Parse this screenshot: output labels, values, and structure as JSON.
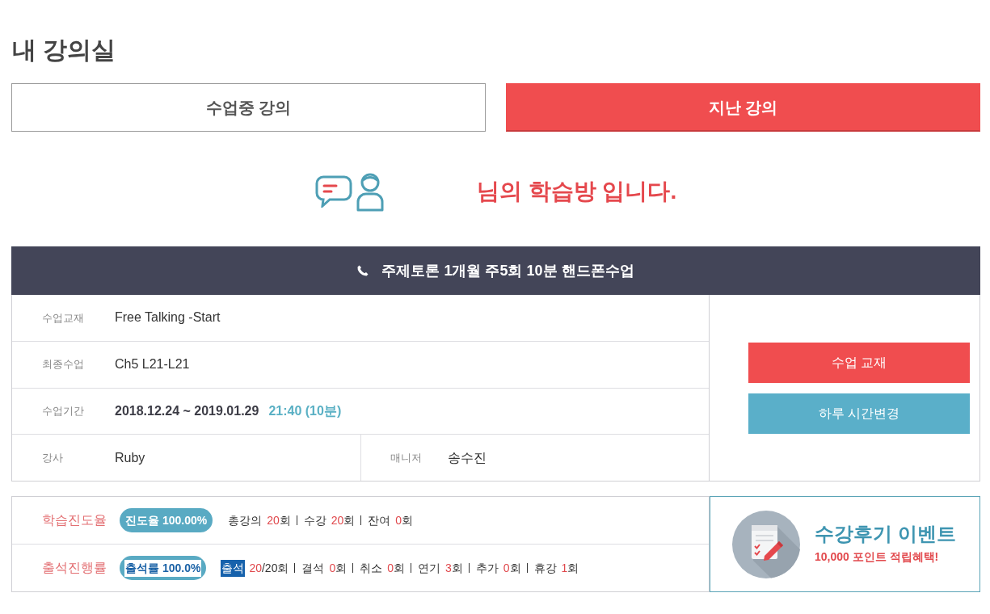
{
  "page_title": "내 강의실",
  "tabs": [
    {
      "label": "수업중 강의",
      "selected": false
    },
    {
      "label": "지난 강의",
      "selected": true
    }
  ],
  "greeting": {
    "text": "님의 학습방 입니다."
  },
  "course": {
    "title": "주제토론 1개월 주5회 10분 핸드폰수업",
    "info_rows": [
      {
        "kind": "text",
        "fields": [
          {
            "label": "수업교재",
            "value": "Free Talking -Start"
          }
        ]
      },
      {
        "kind": "text",
        "fields": [
          {
            "label": "최종수업",
            "value": "Ch5 L21-L21"
          }
        ]
      },
      {
        "kind": "period",
        "fields": [
          {
            "label": "수업기간",
            "value": "2018.12.24 ~ 2019.01.29",
            "time": "21:40 (10분)"
          }
        ]
      },
      {
        "kind": "split",
        "fields": [
          {
            "label": "강사",
            "value": "Ruby"
          },
          {
            "label": "매니저",
            "value": "송수진"
          }
        ]
      }
    ],
    "buttons": [
      {
        "label": "수업 교재",
        "kind": "primary"
      },
      {
        "label": "하루 시간변경",
        "kind": "secondary"
      }
    ]
  },
  "progress": [
    {
      "label": "학습진도율",
      "badge": {
        "text": "진도율 100.00%",
        "highlighted": false
      },
      "stats": [
        {
          "label": "총강의",
          "count": "20",
          "unit": "회",
          "highlighted": false
        },
        {
          "label": "수강",
          "count": "20",
          "unit": "회",
          "highlighted": false
        },
        {
          "label": "잔여",
          "count": "0",
          "unit": "회",
          "highlighted": false
        }
      ]
    },
    {
      "label": "출석진행률",
      "badge": {
        "text": "출석률 100.0%",
        "highlighted": true
      },
      "stats": [
        {
          "label": "출석",
          "count": "20",
          "unit": "/20회",
          "highlighted": true
        },
        {
          "label": "결석",
          "count": "0",
          "unit": "회",
          "highlighted": false
        },
        {
          "label": "취소",
          "count": "0",
          "unit": "회",
          "highlighted": false
        },
        {
          "label": "연기",
          "count": "3",
          "unit": "회",
          "highlighted": false
        },
        {
          "label": "추가",
          "count": "0",
          "unit": "회",
          "highlighted": false
        },
        {
          "label": "휴강",
          "count": "1",
          "unit": "회",
          "highlighted": false
        }
      ]
    }
  ],
  "banner": {
    "title": "수강후기 이벤트",
    "subtitle": "10,000 포인트 적립혜택!"
  }
}
